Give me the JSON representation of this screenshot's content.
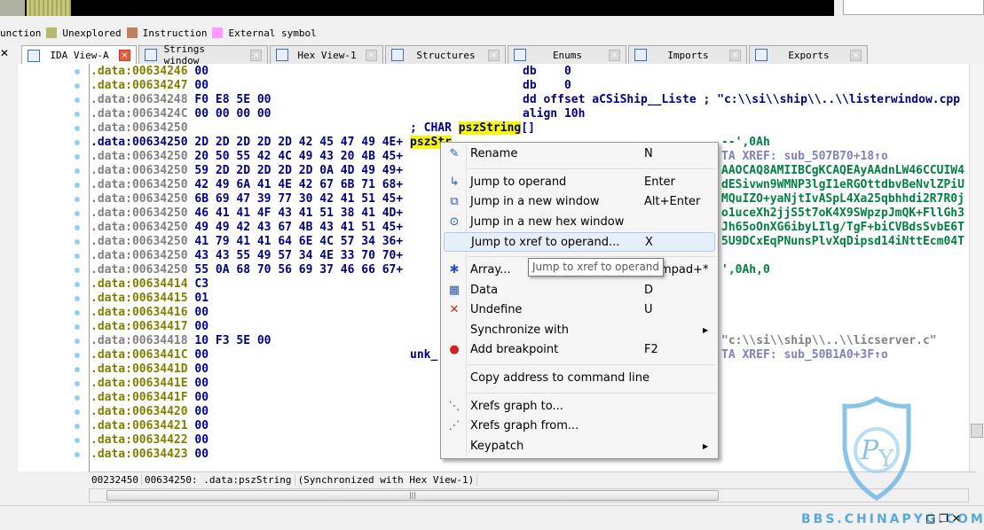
{
  "legend": [
    {
      "label": "unction",
      "color": null
    },
    {
      "label": "Unexplored",
      "color": "#b8b870"
    },
    {
      "label": "Instruction",
      "color": "#c08060"
    },
    {
      "label": "External symbol",
      "color": "#ff99ff"
    }
  ],
  "tabs": [
    {
      "label": "IDA View-A",
      "icon": "ida-view-icon",
      "active": true
    },
    {
      "label": "Strings window",
      "icon": "strings-icon"
    },
    {
      "label": "Hex View-1",
      "icon": "hex-view-icon"
    },
    {
      "label": "Structures",
      "icon": "structures-icon"
    },
    {
      "label": "Enums",
      "icon": "enums-icon"
    },
    {
      "label": "Imports",
      "icon": "imports-icon"
    },
    {
      "label": "Exports",
      "icon": "exports-icon"
    }
  ],
  "lines": [
    {
      "addr": ".data:00634246",
      "c": "o",
      "bytes": "00",
      "right": "db    0",
      "rc": "b"
    },
    {
      "addr": ".data:00634247",
      "c": "o",
      "bytes": "00",
      "right": "db    0",
      "rc": "b"
    },
    {
      "addr": ".data:00634248",
      "c": "g",
      "bytes": "F0 E8 5E 00",
      "right": "dd offset aCSiShip__Liste ; \"c:\\\\si\\\\ship\\\\..\\\\listerwindow.cpp",
      "rc": "b"
    },
    {
      "addr": ".data:0063424C",
      "c": "g",
      "bytes": "00 00 00 00",
      "right": "align 10h",
      "rc": "b"
    },
    {
      "addr": ".data:00634250",
      "c": "g",
      "bytes": "",
      "rest": "; CHAR ",
      "restHl": "pszString",
      "restAfter": "[]"
    },
    {
      "addr": ".data:00634250",
      "c": "b",
      "bytes": "2D 2D 2D 2D 2D 42 45 47 49 4E+",
      "restHl": "pszStr",
      "tail": "--',0Ah",
      "tc": "g"
    },
    {
      "addr": ".data:00634250",
      "c": "g",
      "bytes": "20 50 55 42 4C 49 43 20 4B 45+",
      "tail": "TA XREF: sub_507B70+18↑o",
      "tc": "x"
    },
    {
      "addr": ".data:00634250",
      "c": "g",
      "bytes": "59 2D 2D 2D 2D 2D 0A 4D 49 49+",
      "tail": "AAOCAQ8AMIIBCgKCAQEAyAAdnLW46CCUIW4",
      "tc": "g"
    },
    {
      "addr": ".data:00634250",
      "c": "g",
      "bytes": "42 49 6A 41 4E 42 67 6B 71 68+",
      "tail": "dESivwn9WMNP3lgI1eRGOttdbvBeNvlZPiU",
      "tc": "g"
    },
    {
      "addr": ".data:00634250",
      "c": "g",
      "bytes": "6B 69 47 39 77 30 42 41 51 45+",
      "tail": "MQuIZO+yaNjtIvASpL4Xa25qbhhdi2R7R0j",
      "tc": "g"
    },
    {
      "addr": ".data:00634250",
      "c": "g",
      "bytes": "46 41 41 4F 43 41 51 38 41 4D+",
      "tail": "o1uceXh2jjS5t7oK4X9SWpzpJmQK+FllGh3",
      "tc": "g"
    },
    {
      "addr": ".data:00634250",
      "c": "g",
      "bytes": "49 49 42 43 67 4B 43 41 51 45+",
      "tail": "Jh65oOnXG6ibyLIlg/TgF+biCVBdsSvbE6T",
      "tc": "g"
    },
    {
      "addr": ".data:00634250",
      "c": "g",
      "bytes": "41 79 41 41 64 6E 4C 57 34 36+",
      "tail": "5U9DCxEqPNunsPlvXqDipsd14iNttEcm04T",
      "tc": "g"
    },
    {
      "addr": ".data:00634250",
      "c": "g",
      "bytes": "43 43 55 49 57 34 4E 33 70 70+",
      "tail": "",
      "tc": "g"
    },
    {
      "addr": ".data:00634250",
      "c": "g",
      "bytes": "55 0A 68 70 56 69 37 46 66 67+",
      "tail": "',0Ah,0",
      "tc": "g"
    },
    {
      "addr": ".data:00634414",
      "c": "o",
      "bytes": "C3"
    },
    {
      "addr": ".data:00634415",
      "c": "o",
      "bytes": "01"
    },
    {
      "addr": ".data:00634416",
      "c": "o",
      "bytes": "00"
    },
    {
      "addr": ".data:00634417",
      "c": "o",
      "bytes": "00"
    },
    {
      "addr": ".data:00634418",
      "c": "g",
      "bytes": "10 F3 5E 00",
      "tail": "\"c:\\\\si\\\\ship\\\\..\\\\licserver.c\"",
      "tc": "s"
    },
    {
      "addr": ".data:0063441C",
      "c": "o",
      "bytes": "00",
      "rest": "unk_",
      "tail": "TA XREF: sub_50B1A0+3F↑o",
      "tc": "x"
    },
    {
      "addr": ".data:0063441D",
      "c": "o",
      "bytes": "00"
    },
    {
      "addr": ".data:0063441E",
      "c": "o",
      "bytes": "00"
    },
    {
      "addr": ".data:0063441F",
      "c": "o",
      "bytes": "00"
    },
    {
      "addr": ".data:00634420",
      "c": "o",
      "bytes": "00"
    },
    {
      "addr": ".data:00634421",
      "c": "o",
      "bytes": "00"
    },
    {
      "addr": ".data:00634422",
      "c": "o",
      "bytes": "00"
    },
    {
      "addr": ".data:00634423",
      "c": "o",
      "bytes": "00"
    }
  ],
  "status": {
    "offset": "00232450",
    "location": "00634250: .data:pszString",
    "sync": "(Synchronized with Hex View-1)"
  },
  "menu": {
    "items": [
      {
        "label": "Rename",
        "shortcut": "N",
        "icon": "rename-icon",
        "sepAfter": true
      },
      {
        "label": "Jump to operand",
        "shortcut": "Enter",
        "icon": "jump-icon"
      },
      {
        "label": "Jump in a new window",
        "shortcut": "Alt+Enter",
        "icon": "jump-new-window-icon"
      },
      {
        "label": "Jump in a new hex window",
        "shortcut": "",
        "icon": "jump-hex-window-icon"
      },
      {
        "label": "Jump to xref to operand...",
        "shortcut": "X",
        "icon": "",
        "active": true,
        "sepAfter": true
      },
      {
        "label": "Array...",
        "shortcut": "Numpad+*",
        "icon": "array-icon"
      },
      {
        "label": "Data",
        "shortcut": "D",
        "icon": "data-icon"
      },
      {
        "label": "Undefine",
        "shortcut": "U",
        "icon": "undefine-icon"
      },
      {
        "label": "Synchronize with",
        "shortcut": "",
        "icon": "",
        "submenu": true
      },
      {
        "label": "Add breakpoint",
        "shortcut": "F2",
        "icon": "breakpoint-icon",
        "sepAfter": true
      },
      {
        "label": "Copy address to command line",
        "shortcut": "",
        "icon": "",
        "sepAfter": true
      },
      {
        "label": "Xrefs graph to...",
        "shortcut": "",
        "icon": "xrefs-graph-to-icon"
      },
      {
        "label": "Xrefs graph from...",
        "shortcut": "",
        "icon": "xrefs-graph-from-icon"
      },
      {
        "label": "Keypatch",
        "shortcut": "",
        "icon": "",
        "submenu": true
      }
    ]
  },
  "tooltip": "Jump to xref to operand",
  "watermark": {
    "text": "BBS.CHINAPYG.COM",
    "logo": "PY",
    "color": "#5aa8dc"
  }
}
